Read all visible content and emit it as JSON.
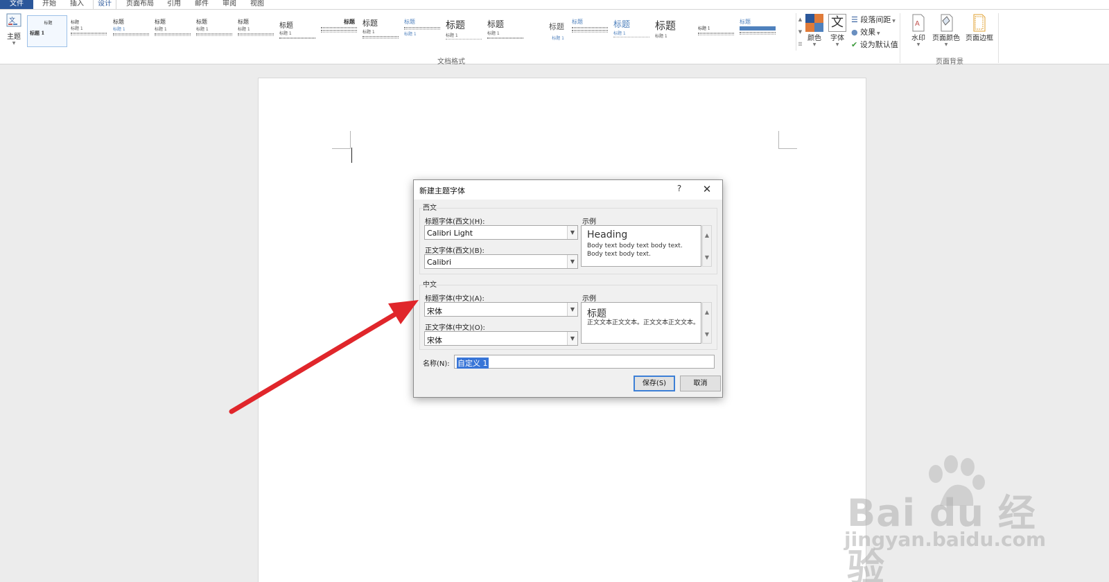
{
  "tabs": [
    {
      "label": "文件"
    },
    {
      "label": "开始"
    },
    {
      "label": "插入"
    },
    {
      "label": "设计"
    },
    {
      "label": "页面布局"
    },
    {
      "label": "引用"
    },
    {
      "label": "邮件"
    },
    {
      "label": "审阅"
    },
    {
      "label": "视图"
    }
  ],
  "ribbon": {
    "theme_label": "主题",
    "gallery": [
      {
        "title": "标题",
        "sub": "标题 1"
      },
      {
        "title": "标题",
        "sub": "标题 1"
      },
      {
        "title": "标题",
        "sub": "标题 1"
      },
      {
        "title": "标题",
        "sub": "标题 1"
      },
      {
        "title": "标题",
        "sub": "标题 1"
      },
      {
        "title": "标题",
        "sub": "标题 1"
      },
      {
        "title": "标题",
        "sub": "标题 1"
      },
      {
        "title": "标题",
        "sub": "标题 1"
      },
      {
        "title": "标题",
        "sub": "标题 1"
      },
      {
        "title": "标题",
        "sub": "标题 1"
      },
      {
        "title": "标题",
        "sub": "标题 1"
      },
      {
        "title": "标题",
        "sub": "标题 1"
      },
      {
        "title": "标题",
        "sub": "标题 1"
      },
      {
        "title": "标题",
        "sub": "标题 1"
      },
      {
        "title": "标题",
        "sub": "标题 1"
      },
      {
        "title": "标题",
        "sub": "标题 1"
      },
      {
        "title": "标题",
        "sub": "标题 1"
      },
      {
        "title": "标题",
        "sub": "标题 1"
      }
    ],
    "group_doc_format": "文档格式",
    "colors_label": "颜色",
    "fonts_label": "字体",
    "para_spacing": "段落间距",
    "effects": "效果",
    "set_default": "设为默认值",
    "watermark_label": "水印",
    "page_color_label": "页面颜色",
    "page_border_label": "页面边框",
    "group_page_bg": "页面背景"
  },
  "dialog": {
    "title": "新建主题字体",
    "help": "?",
    "western": {
      "group_title": "西文",
      "heading_label": "标题字体(西文)(H):",
      "heading_value": "Calibri Light",
      "body_label": "正文字体(西文)(B):",
      "body_value": "Calibri",
      "sample_label": "示例",
      "sample_heading": "Heading",
      "sample_body": "Body text body text body text. Body text body text."
    },
    "chinese": {
      "group_title": "中文",
      "heading_label": "标题字体(中文)(A):",
      "heading_value": "宋体",
      "body_label": "正文字体(中文)(O):",
      "body_value": "宋体",
      "sample_label": "示例",
      "sample_heading": "标题",
      "sample_body": "正文文本正文文本。正文文本正文文本。"
    },
    "name_label": "名称(N):",
    "name_value": "自定义 1",
    "save_label": "保存(S)",
    "cancel_label": "取消"
  },
  "watermark": {
    "brand": "Bai du 经验",
    "url": "jingyan.baidu.com"
  },
  "colors": {
    "accent": "#2b579a",
    "arrow": "#e0262b"
  }
}
